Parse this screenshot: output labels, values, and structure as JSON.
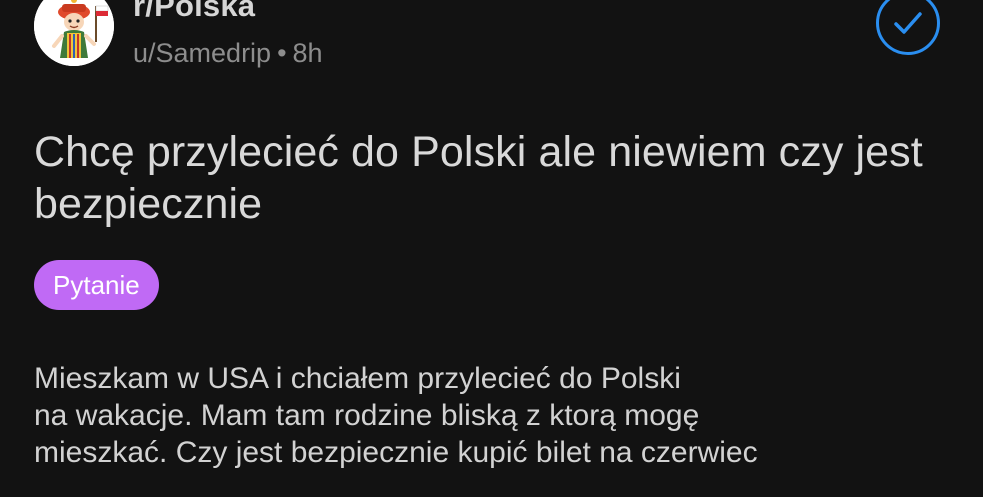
{
  "post": {
    "subreddit": "r/Polska",
    "author": "u/Samedrip",
    "separator": "•",
    "age": "8h",
    "title": "Chcę przylecieć do Polski ale niewiem czy jest bezpiecznie",
    "flair": "Pytanie",
    "body_lines": [
      "Mieszkam w USA i chciałem przylecieć do Polski",
      "na wakacje. Mam tam rodzine bliską z ktorą mogę",
      "mieszkać. Czy jest bezpiecznie kupić bilet na czerwiec"
    ]
  },
  "colors": {
    "background": "#121212",
    "flair": "#c06af5",
    "check_accent": "#2a8ef0",
    "meta_text": "#8d8d8d"
  },
  "icons": {
    "avatar": "subreddit-avatar-icon",
    "check": "check-circle-icon"
  }
}
